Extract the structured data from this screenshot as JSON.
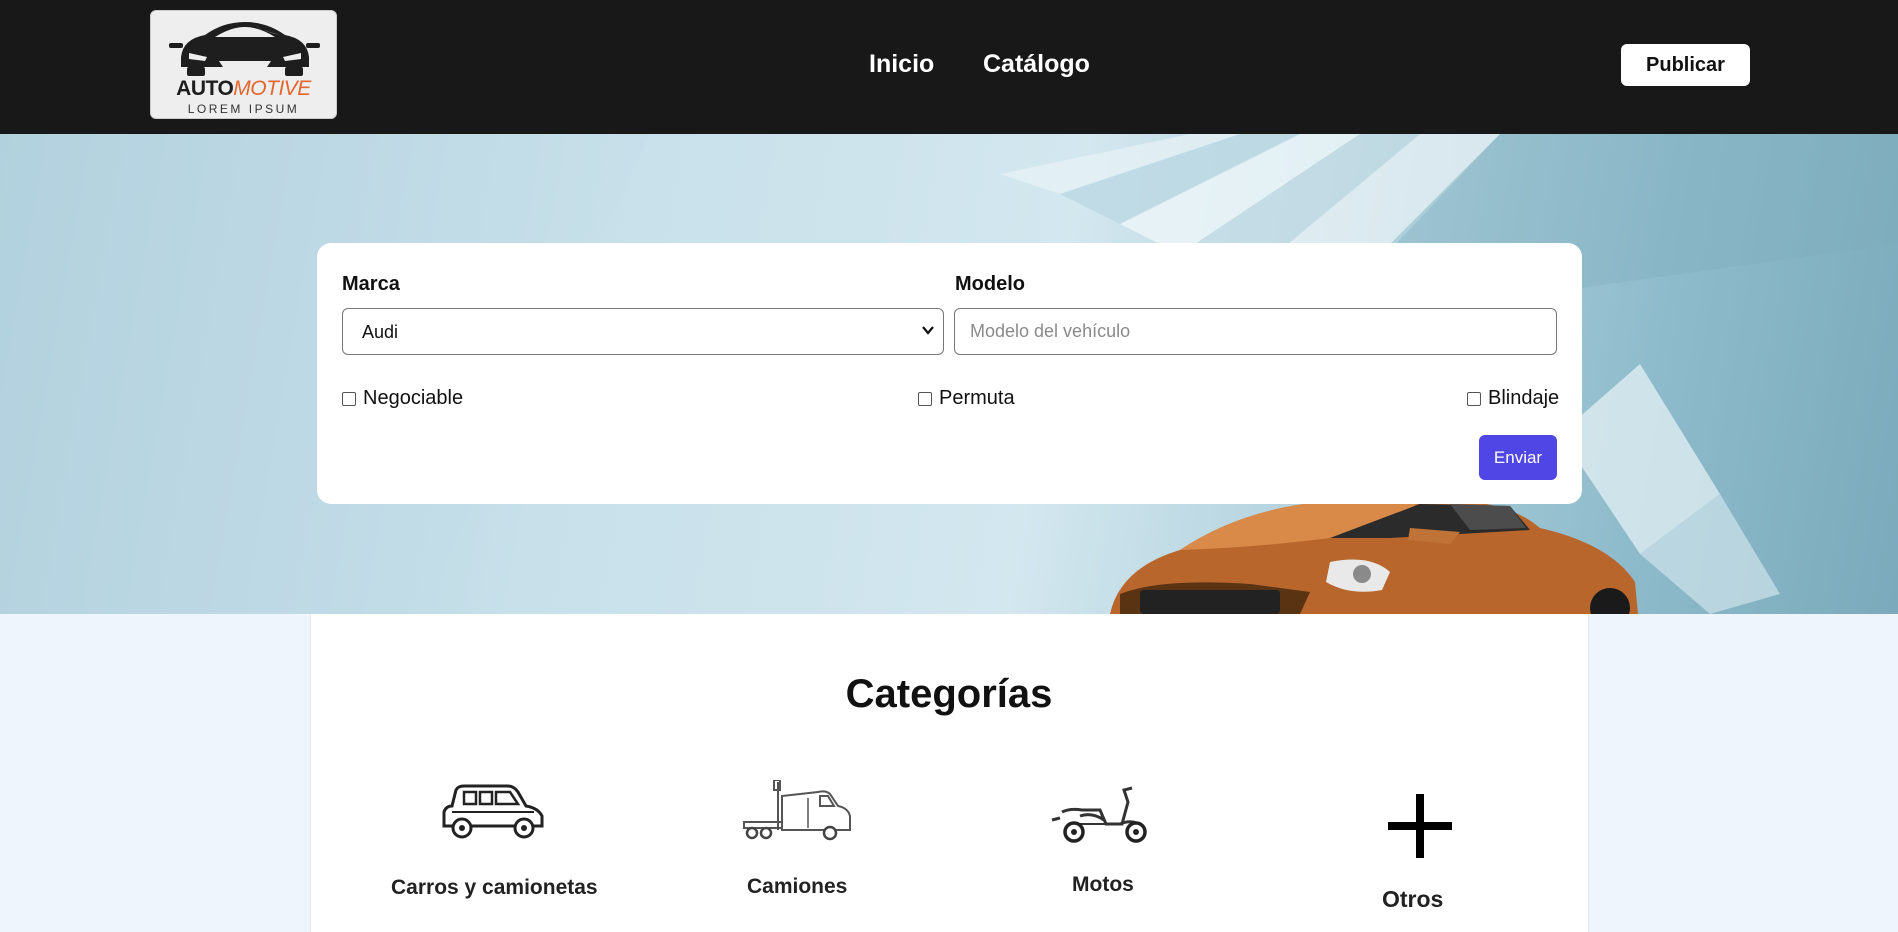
{
  "header": {
    "logo": {
      "word_primary": "AUTO",
      "word_accent": "MOTIVE",
      "tagline": "LOREM IPSUM"
    },
    "nav": [
      {
        "label": "Inicio"
      },
      {
        "label": "Catálogo"
      }
    ],
    "publish_label": "Publicar"
  },
  "search": {
    "brand_label": "Marca",
    "brand_value": "Audi",
    "model_label": "Modelo",
    "model_value": "",
    "model_placeholder": "Modelo del vehículo",
    "checkboxes": [
      {
        "label": "Negociable",
        "checked": false
      },
      {
        "label": "Permuta",
        "checked": false
      },
      {
        "label": "Blindaje",
        "checked": false
      }
    ],
    "submit_label": "Enviar"
  },
  "categories": {
    "title": "Categorías",
    "items": [
      {
        "label": "Carros y camionetas",
        "icon": "suv-icon"
      },
      {
        "label": "Camiones",
        "icon": "truck-icon"
      },
      {
        "label": "Motos",
        "icon": "scooter-icon"
      },
      {
        "label": "Otros",
        "icon": "plus-icon"
      }
    ]
  },
  "colors": {
    "header_bg": "#181818",
    "accent": "#4f46e5",
    "logo_accent": "#e4662e",
    "page_bg": "#eef5fd"
  }
}
